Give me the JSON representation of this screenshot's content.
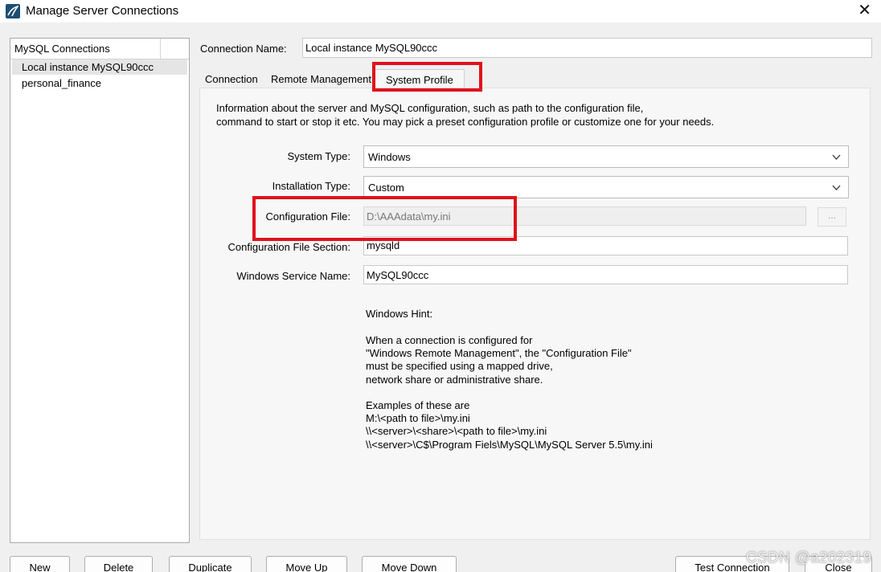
{
  "window": {
    "title": "Manage Server Connections",
    "close_glyph": "✕",
    "icon": "mysql-workbench-icon"
  },
  "connections": {
    "header": "MySQL Connections",
    "items": [
      {
        "label": "Local instance MySQL90ccc",
        "selected": true
      },
      {
        "label": "personal_finance",
        "selected": false
      }
    ]
  },
  "connection_name": {
    "label": "Connection Name:",
    "value": "Local instance MySQL90ccc"
  },
  "tabs": [
    {
      "label": "Connection",
      "active": false
    },
    {
      "label": "Remote Management",
      "active": false
    },
    {
      "label": "System Profile",
      "active": true
    }
  ],
  "system_profile": {
    "description_line1": "Information about the server and MySQL configuration, such as path to the configuration file,",
    "description_line2": "command to start or stop it etc. You may pick a preset configuration profile or customize one for your needs.",
    "system_type": {
      "label": "System Type:",
      "value": "Windows"
    },
    "installation_type": {
      "label": "Installation Type:",
      "value": "Custom"
    },
    "config_file": {
      "label": "Configuration File:",
      "value": "D:\\AAAdata\\my.ini",
      "browse_label": "..."
    },
    "config_section": {
      "label": "Configuration File Section:",
      "value": "mysqld"
    },
    "service_name": {
      "label": "Windows Service Name:",
      "value": "MySQL90ccc"
    },
    "hint_lines": [
      "Windows Hint:",
      "When a connection is configured for",
      "\"Windows Remote Management\", the \"Configuration File\"",
      "must be specified using a mapped drive,",
      "network share or administrative share.",
      "Examples of these are",
      "M:\\<path to file>\\my.ini",
      "\\\\<server>\\<share>\\<path to file>\\my.ini",
      "\\\\<server>\\C$\\Program Fiels\\MySQL\\MySQL Server 5.5\\my.ini"
    ]
  },
  "buttons": {
    "new": "New",
    "delete": "Delete",
    "duplicate": "Duplicate",
    "move_up": "Move Up",
    "move_down": "Move Down",
    "test_connection": "Test Connection",
    "close": "Close"
  },
  "watermark": "CSDN @a202319",
  "colors": {
    "highlight": "#e0121c",
    "selected_row": "#e5e5e5",
    "window_bg": "#f0f0f0"
  }
}
